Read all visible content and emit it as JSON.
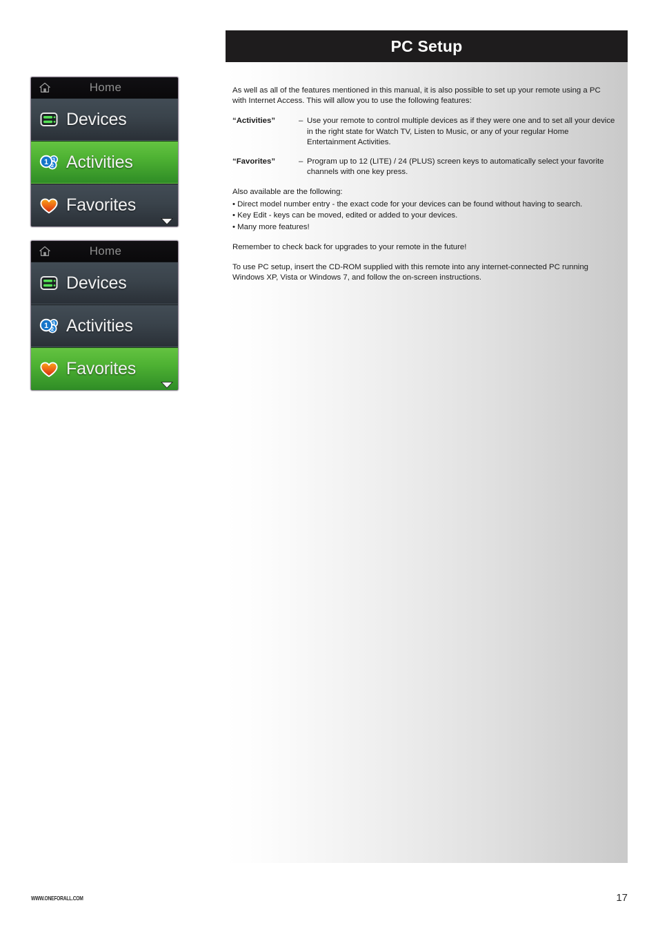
{
  "header": {
    "title": "PC Setup"
  },
  "content": {
    "intro": "As well as all of the features mentioned in this manual, it is also possible to set up your remote using a PC with Internet Access. This will allow you to use the following features:",
    "definitions": [
      {
        "term": "“Activities”",
        "dash": "–",
        "body": "Use your remote to control multiple devices as if they were one and to set all your device in the right state for Watch TV, Listen to Music, or any of your regular Home Entertainment Activities."
      },
      {
        "term": "“Favorites”",
        "dash": "–",
        "body": "Program up to 12 (LITE) / 24 (PLUS) screen keys to automatically select your favorite channels with one key press."
      }
    ],
    "also_lead": "Also available are the following:",
    "bullets": [
      "• Direct model number entry -  the exact code for your devices can be found without having to search.",
      "• Key Edit - keys can be moved, edited or added to your devices.",
      "• Many more features!"
    ],
    "remember": "Remember to check back for upgrades to your remote in the future!",
    "closing": "To use PC setup, insert the CD-ROM supplied with this remote into any internet-connected PC running Windows XP, Vista or Windows 7, and follow the on-screen instructions."
  },
  "screens": [
    {
      "title": "Home",
      "home_icon": "home-icon",
      "rows": [
        {
          "label": "Devices",
          "icon": "devices-icon",
          "highlighted": false
        },
        {
          "label": "Activities",
          "icon": "activities-icon",
          "highlighted": true
        },
        {
          "label": "Favorites",
          "icon": "favorites-icon",
          "highlighted": false
        }
      ],
      "scroll_indicator": "chevron-down-icon"
    },
    {
      "title": "Home",
      "home_icon": "home-icon",
      "rows": [
        {
          "label": "Devices",
          "icon": "devices-icon",
          "highlighted": false
        },
        {
          "label": "Activities",
          "icon": "activities-icon",
          "highlighted": false
        },
        {
          "label": "Favorites",
          "icon": "favorites-icon",
          "highlighted": true
        }
      ],
      "scroll_indicator": "chevron-down-icon"
    }
  ],
  "footer": {
    "url": "WWW.ONEFORALL.COM",
    "page_number": "17"
  },
  "colors": {
    "header_bg": "#1e1c1d",
    "highlight_green_top": "#64c341",
    "highlight_green_bottom": "#2f8c26",
    "row_dark_top": "#424c55",
    "row_dark_bottom": "#2a3037",
    "title_text": "#8f8f8f",
    "label_text": "#f2f2f2"
  }
}
